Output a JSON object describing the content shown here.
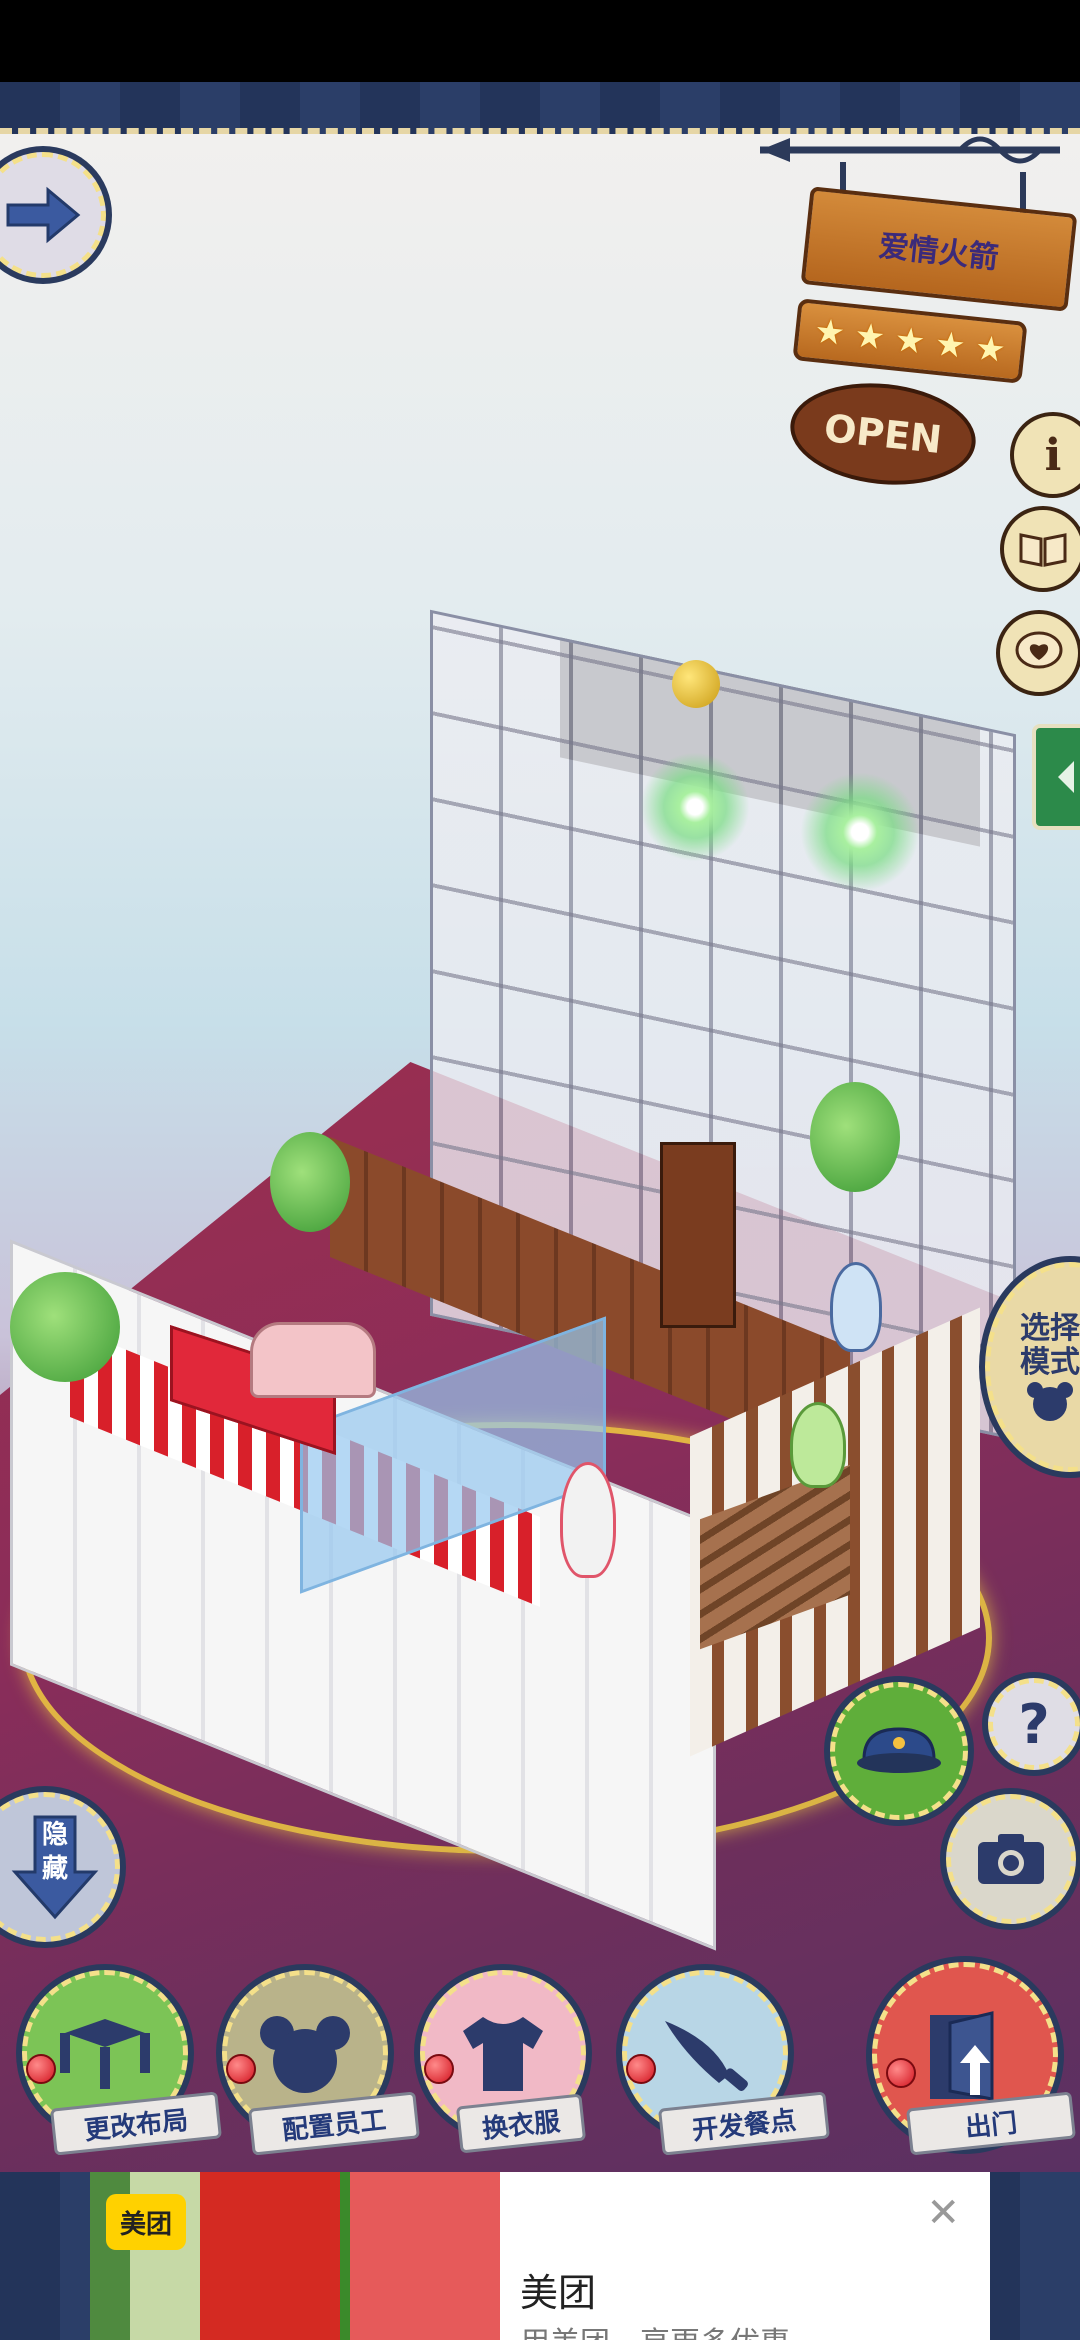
{
  "restaurant": {
    "name": "爱情火箭",
    "rating": 5,
    "status_sign": "OPEN"
  },
  "side_buttons": {
    "info_icon": "i",
    "select_mode_label": "选择\n模式",
    "hide_label": "隐\n藏",
    "help_icon": "?"
  },
  "bottom_bar": [
    {
      "label": "更改布局",
      "icon": "table-icon"
    },
    {
      "label": "配置员工",
      "icon": "bear-head-icon"
    },
    {
      "label": "换衣服",
      "icon": "tshirt-icon"
    },
    {
      "label": "开发餐点",
      "icon": "knife-icon"
    },
    {
      "label": "出门",
      "icon": "door-exit-icon"
    }
  ],
  "ad": {
    "brand_logo": "美团",
    "title": "美团",
    "subtitle": "用美团，享更多优惠"
  },
  "colors": {
    "border_navy": "#23345a",
    "stitch_yellow": "#f4e08a",
    "label_text": "#243a7a"
  }
}
